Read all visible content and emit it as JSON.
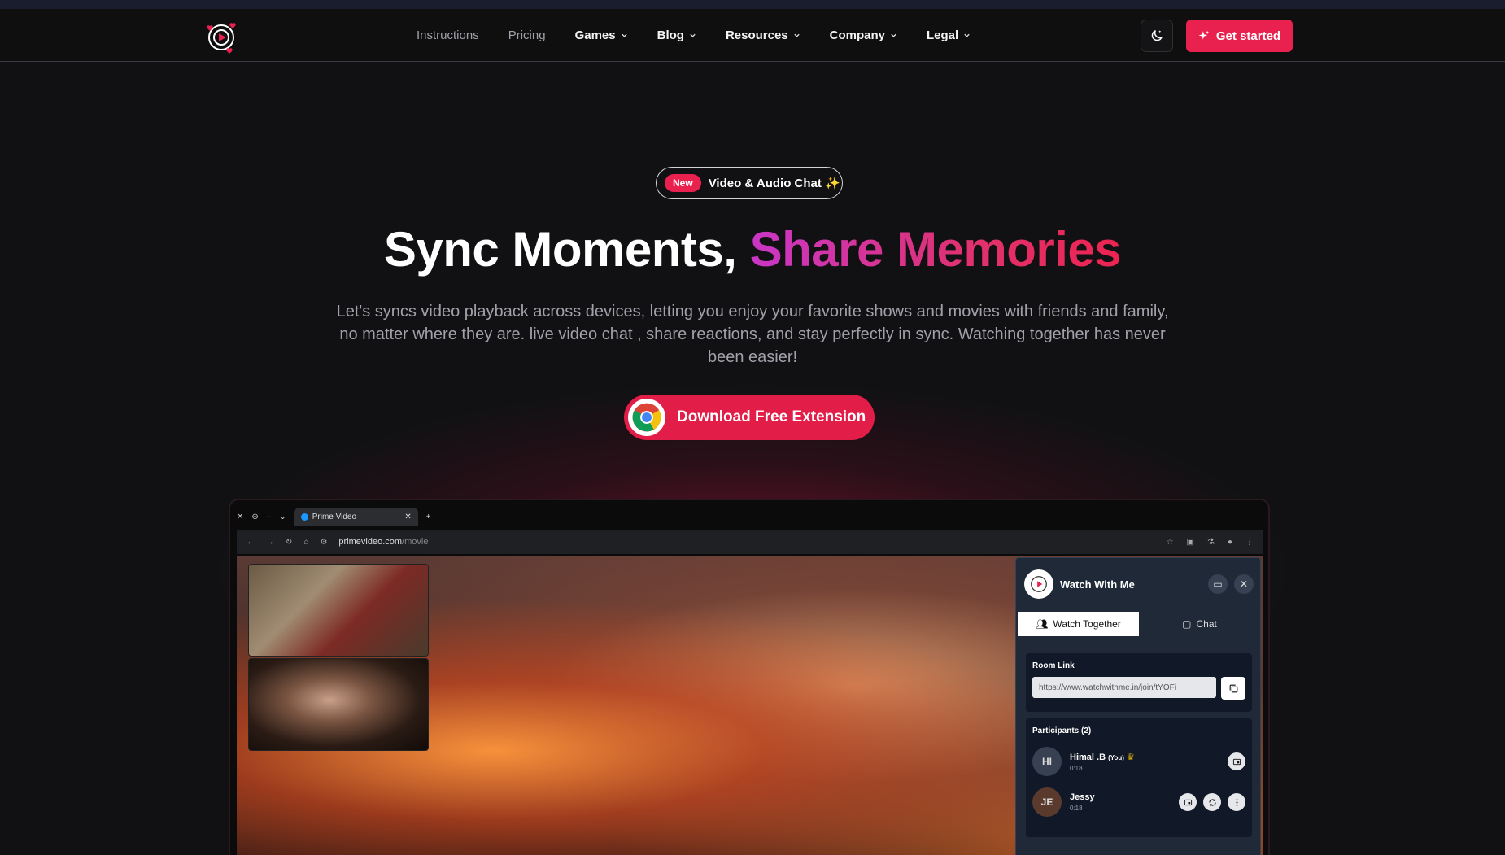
{
  "nav": {
    "links": [
      "Instructions",
      "Pricing"
    ],
    "dropdowns": [
      "Games",
      "Blog",
      "Resources",
      "Company",
      "Legal"
    ],
    "cta": "Get started",
    "accent": "#e8214f"
  },
  "hero": {
    "badge_new": "New",
    "badge_text": "Video & Audio Chat ✨",
    "title_plain": "Sync Moments, ",
    "title_gradient": "Share Memories",
    "subtitle": "Let's syncs video playback across devices, letting you enjoy your favorite shows and movies with friends and family, no matter where they are. live video chat , share reactions, and stay perfectly in sync. Watching together has never been easier!",
    "download": "Download Free Extension"
  },
  "mock": {
    "tab_title": "Prime Video",
    "url_host": "primevideo.com",
    "url_path": "/movie",
    "panel": {
      "title": "Watch With Me",
      "tab_watch": "Watch Together",
      "tab_chat": "Chat",
      "room_label": "Room Link",
      "room_value": "https://www.watchwithme.in/join/tYOFi",
      "participants_label": "Participants (2)",
      "participants": [
        {
          "initials": "HI",
          "name": "Himal .B",
          "tag": "(You)",
          "time": "0:18"
        },
        {
          "initials": "JE",
          "name": "Jessy",
          "tag": "",
          "time": "0:18"
        }
      ]
    }
  }
}
